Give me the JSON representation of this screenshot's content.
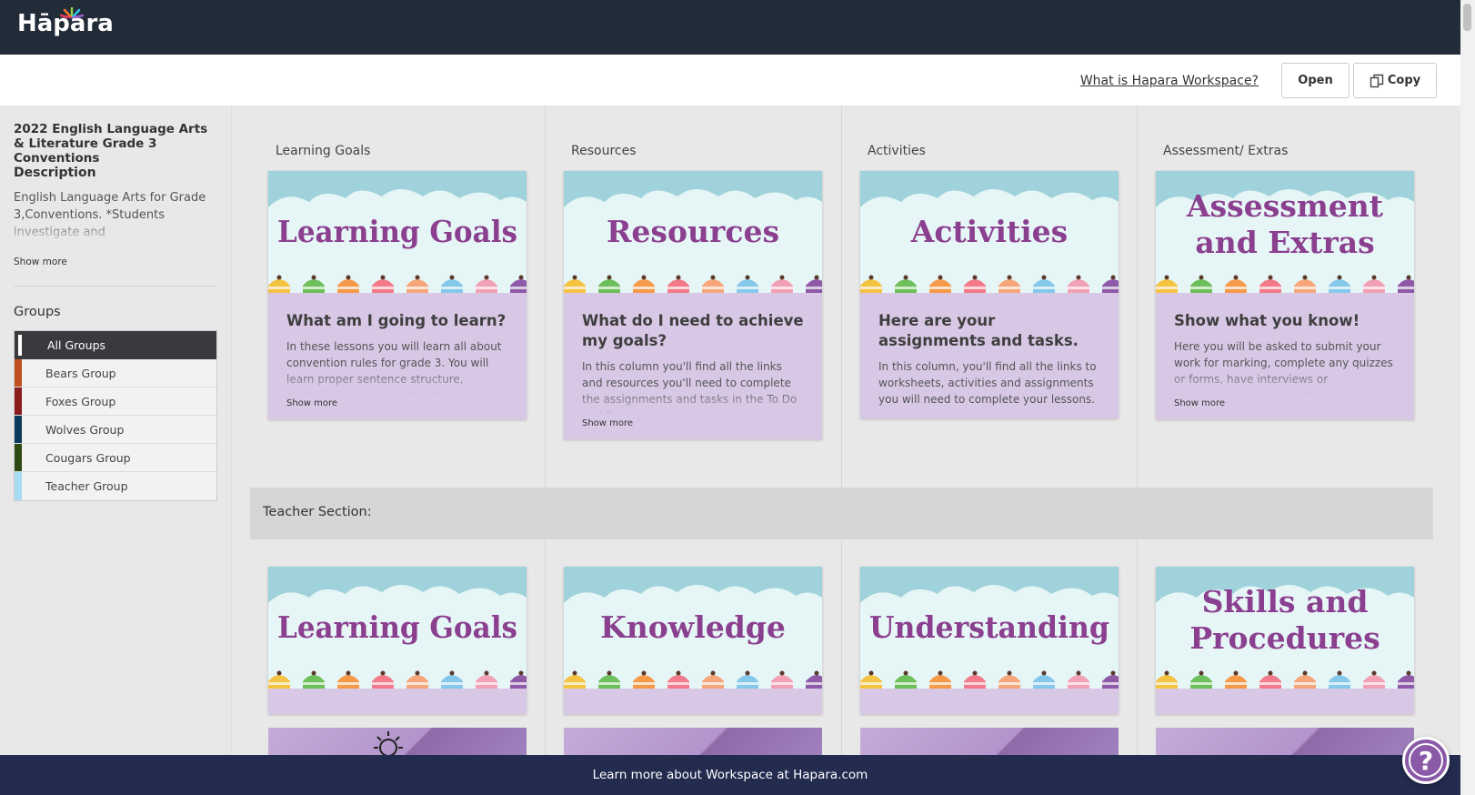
{
  "app": {
    "logo": "Hāpara"
  },
  "actionbar": {
    "what_is_link": "What is Hapara Workspace?",
    "open_label": "Open",
    "copy_label": "Copy"
  },
  "sidebar": {
    "course_title": "2022 English Language Arts & Literature Grade 3 Conventions",
    "description_label": "Description",
    "description_text": "English Language Arts for Grade 3,Conventions. *Students investigate and",
    "show_more": "Show more",
    "groups_label": "Groups",
    "groups": [
      {
        "label": "All Groups",
        "color": "#ffffff"
      },
      {
        "label": "Bears Group",
        "color": "#c0501f"
      },
      {
        "label": "Foxes Group",
        "color": "#8b1c1c"
      },
      {
        "label": "Wolves Group",
        "color": "#0d3b5c"
      },
      {
        "label": "Cougars Group",
        "color": "#2e4a14"
      },
      {
        "label": "Teacher Group",
        "color": "#a8dcf5"
      }
    ]
  },
  "columns": [
    {
      "title": "Learning Goals",
      "banner": [
        "Learning Goals"
      ],
      "heading": "What am I going to learn?",
      "text": "In these lessons you will learn all about convention rules for grade 3. You will learn proper sentence structure, capitalization and punctuation, and quotation marks. You",
      "show_more": "Show more"
    },
    {
      "title": "Resources",
      "banner": [
        "Resources"
      ],
      "heading": "What do I need to achieve my goals?",
      "text": "In this column you'll find all the links and resources you'll need to complete the assignments and tasks in the To Do and Extra columns.",
      "show_more": "Show more"
    },
    {
      "title": "Activities",
      "banner": [
        "Activities"
      ],
      "heading": "Here are your assignments and tasks.",
      "text": "In this column, you'll find all the links to worksheets, activities and assignments you will need to complete your lessons.",
      "show_more": ""
    },
    {
      "title": "Assessment/ Extras",
      "banner": [
        "Assessment",
        "and Extras"
      ],
      "heading": "Show what you know!",
      "text": "Here you will be asked to submit your work for marking, complete any quizzes or forms, have interviews or conversations to show what you have learned! It may also be",
      "show_more": "Show more"
    }
  ],
  "teacher_section": {
    "label": "Teacher Section:",
    "cards": [
      {
        "banner": [
          "Learning Goals"
        ]
      },
      {
        "banner": [
          "Knowledge"
        ]
      },
      {
        "banner": [
          "Understanding"
        ]
      },
      {
        "banner": [
          "Skills and",
          "Procedures"
        ]
      }
    ]
  },
  "footer": {
    "text": "Learn more about Workspace at Hapara.com"
  },
  "help": {
    "icon": "question-mark-icon"
  },
  "colors": {
    "topbar": "#222b38",
    "banner_title": "#8b3f8f",
    "card_body": "#d8c8e6",
    "footer": "#232b4f"
  }
}
